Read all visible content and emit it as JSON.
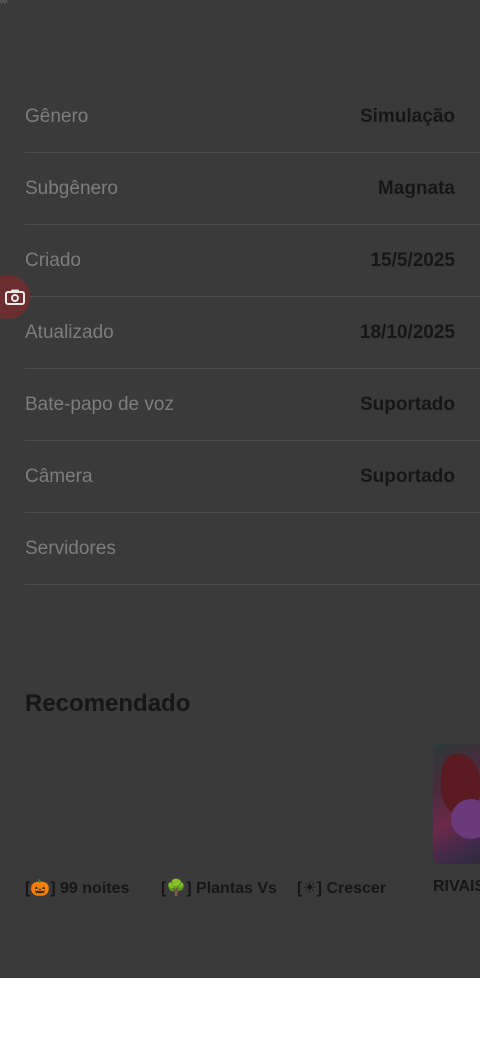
{
  "status": {
    "time_fragment": "∞"
  },
  "info": [
    {
      "label": "Gênero",
      "value": "Simulação"
    },
    {
      "label": "Subgênero",
      "value": "Magnata"
    },
    {
      "label": "Criado",
      "value": "15/5/2025"
    },
    {
      "label": "Atualizado",
      "value": "18/10/2025"
    },
    {
      "label": "Bate-papo de voz",
      "value": "Suportado"
    },
    {
      "label": "Câmera",
      "value": "Suportado"
    },
    {
      "label": "Servidores",
      "value": ""
    }
  ],
  "recommended": {
    "title": "Recomendado",
    "items": [
      {
        "name": "[🎃] 99 noites"
      },
      {
        "name": "[🌳] Plantas Vs"
      },
      {
        "name": "[☀] Crescer"
      },
      {
        "name": "RIVAIS"
      }
    ]
  }
}
